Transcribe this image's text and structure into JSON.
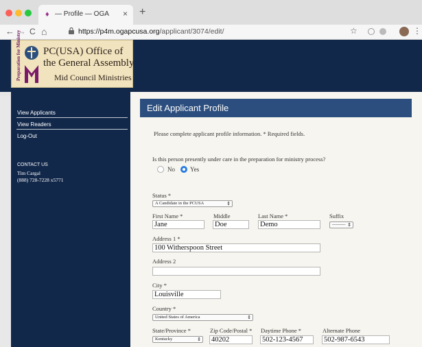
{
  "browser": {
    "tab_title": "— Profile — OGA",
    "tab_close": "×",
    "new_tab": "+",
    "url_host": "https://p4m.ogapcusa.org",
    "url_path": "/applicant/3074/edit/",
    "back": "←",
    "forward": "→",
    "reload": "C",
    "home": "⌂",
    "star": "☆",
    "menu": "⋮"
  },
  "logo": {
    "side_text": "Preparation for Ministry",
    "line1": "PC(USA) Office of",
    "line2": "the General Assembly",
    "line3": "Mid Council Ministries"
  },
  "sidebar": {
    "links": [
      {
        "label": "View Applicants"
      },
      {
        "label": "View Readers"
      },
      {
        "label": "Log-Out"
      }
    ],
    "contact_heading": "CONTACT US",
    "contact_name": "Tim Cargal",
    "contact_phone": "(888) 728-7228 x5771"
  },
  "main": {
    "title": "Edit Applicant Profile",
    "instructions": "Please complete applicant profile information. * Required fields.",
    "care_question": "Is this person presently under care in the preparation for ministry process?",
    "care_options": [
      {
        "label": "No",
        "selected": false
      },
      {
        "label": "Yes",
        "selected": true
      }
    ]
  },
  "form": {
    "status_label": "Status *",
    "status_value": "A Candidate in the PCUSA",
    "first_name_label": "First Name *",
    "first_name_value": "Jane",
    "middle_label": "Middle",
    "middle_value": "Doe",
    "last_name_label": "Last Name *",
    "last_name_value": "Demo",
    "suffix_label": "Suffix",
    "suffix_value": "---------",
    "address1_label": "Address 1 *",
    "address1_value": "100 Witherspoon Street",
    "address2_label": "Address 2",
    "address2_value": "",
    "city_label": "City *",
    "city_value": "Louisville",
    "country_label": "Country *",
    "country_value": "United States of America",
    "state_label": "State/Province *",
    "state_value": "Kentucky",
    "zip_label": "Zip Code/Postal *",
    "zip_value": "40202",
    "day_phone_label": "Daytime Phone *",
    "day_phone_value": "502-123-4567",
    "alt_phone_label": "Alternate Phone",
    "alt_phone_value": "502-987-6543",
    "caret": "⇕"
  },
  "colors": {
    "navy": "#12284a",
    "title_bar": "#2c4e7e",
    "radio_accent": "#2a7ce0",
    "panel_bg": "#f7f5ef"
  }
}
